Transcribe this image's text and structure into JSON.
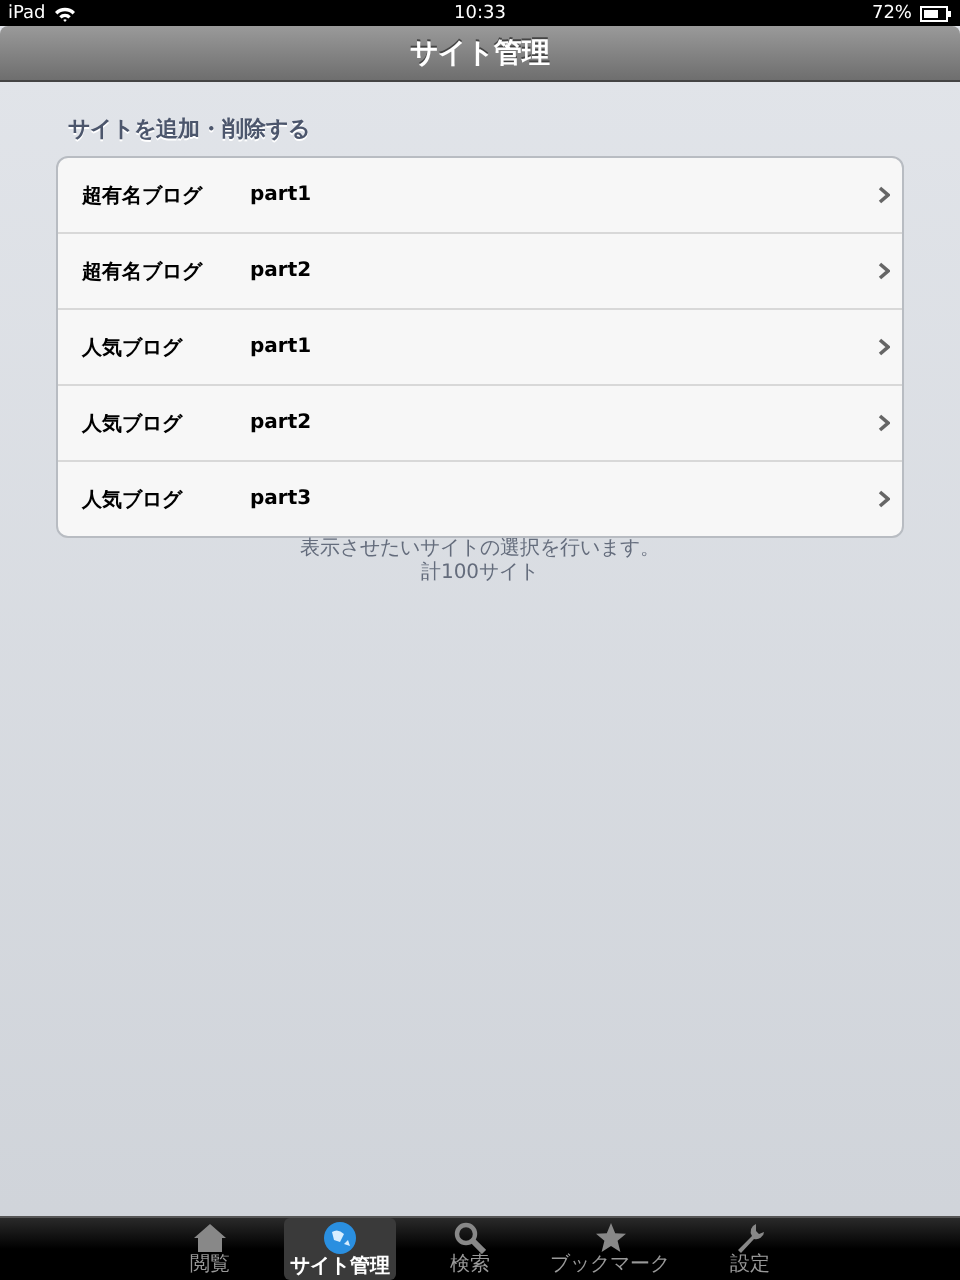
{
  "status_bar": {
    "device": "iPad",
    "time": "10:33",
    "battery": "72%"
  },
  "nav": {
    "title": "サイト管理"
  },
  "section": {
    "header": "サイトを追加・削除する",
    "rows": [
      {
        "name": "超有名ブログ",
        "part": "part1"
      },
      {
        "name": "超有名ブログ",
        "part": "part2"
      },
      {
        "name": "人気ブログ",
        "part": "part1"
      },
      {
        "name": "人気ブログ",
        "part": "part2"
      },
      {
        "name": "人気ブログ",
        "part": "part3"
      }
    ],
    "footer": [
      "表示させたいサイトの選択を行います。",
      "計100サイト"
    ]
  },
  "tabs": [
    {
      "label": "閲覧",
      "kind": "house",
      "selected": false
    },
    {
      "label": "サイト管理",
      "kind": "globe",
      "selected": true
    },
    {
      "label": "検索",
      "kind": "search",
      "selected": false
    },
    {
      "label": "ブックマーク",
      "kind": "star",
      "selected": false
    },
    {
      "label": "設定",
      "kind": "wrench",
      "selected": false
    }
  ]
}
